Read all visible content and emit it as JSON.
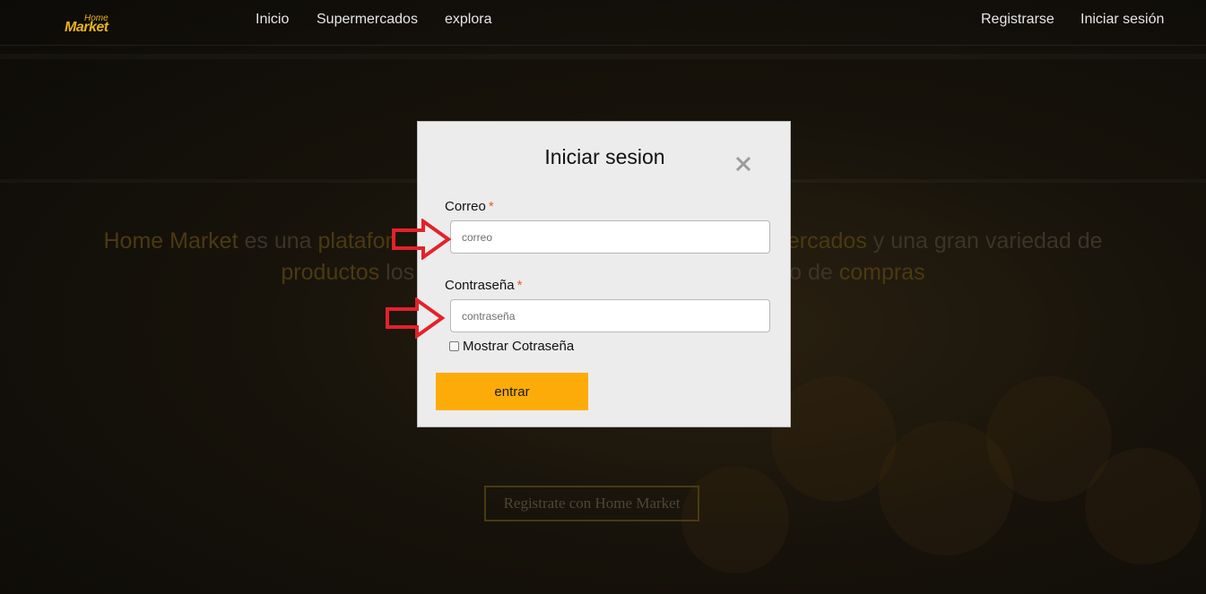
{
  "navbar": {
    "logo_top": "Home",
    "logo_bottom": "Market",
    "links": [
      "Inicio",
      "Supermercados",
      "explora"
    ],
    "register": "Registrarse",
    "login": "Iniciar sesión"
  },
  "hero": {
    "line1_a": "Home Market",
    "line1_b": " es una ",
    "line1_c": "platafor",
    "line1_d": "ercados",
    "line1_e": " y una gran variedad de",
    "line2_a": "productos",
    "line2_b": " los",
    "line2_c": "o de ",
    "line2_d": "compras",
    "cta": "Registrate con Home Market"
  },
  "modal": {
    "title": "Iniciar sesion",
    "email": {
      "label": "Correo",
      "required_mark": "*",
      "placeholder": "correo"
    },
    "password": {
      "label": "Contraseña",
      "required_mark": "*",
      "placeholder": "contraseña"
    },
    "show_password_label": "Mostrar Cotraseña",
    "show_password_checked": false,
    "submit_label": "entrar"
  },
  "colors": {
    "brand": "#e9b31a",
    "submit_button": "#fdab09",
    "required_mark": "#e0602a",
    "annotation_arrow": "#e3222a",
    "modal_background": "#ececec"
  },
  "icons": {
    "close": "close-icon",
    "annotation": "red-arrow-icon"
  }
}
